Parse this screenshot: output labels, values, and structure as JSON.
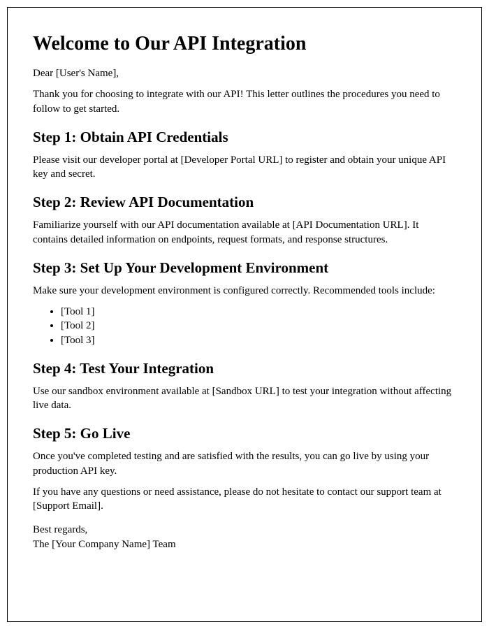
{
  "title": "Welcome to Our API Integration",
  "salutation": "Dear [User's Name],",
  "intro": "Thank you for choosing to integrate with our API! This letter outlines the procedures you need to follow to get started.",
  "steps": {
    "s1": {
      "heading": "Step 1: Obtain API Credentials",
      "body": "Please visit our developer portal at [Developer Portal URL] to register and obtain your unique API key and secret."
    },
    "s2": {
      "heading": "Step 2: Review API Documentation",
      "body": "Familiarize yourself with our API documentation available at [API Documentation URL]. It contains detailed information on endpoints, request formats, and response structures."
    },
    "s3": {
      "heading": "Step 3: Set Up Your Development Environment",
      "body": "Make sure your development environment is configured correctly. Recommended tools include:",
      "tools": [
        "[Tool 1]",
        "[Tool 2]",
        "[Tool 3]"
      ]
    },
    "s4": {
      "heading": "Step 4: Test Your Integration",
      "body": "Use our sandbox environment available at [Sandbox URL] to test your integration without affecting live data."
    },
    "s5": {
      "heading": "Step 5: Go Live",
      "body": "Once you've completed testing and are satisfied with the results, you can go live by using your production API key."
    }
  },
  "support": "If you have any questions or need assistance, please do not hesitate to contact our support team at [Support Email].",
  "closing_line1": "Best regards,",
  "closing_line2": "The [Your Company Name] Team"
}
